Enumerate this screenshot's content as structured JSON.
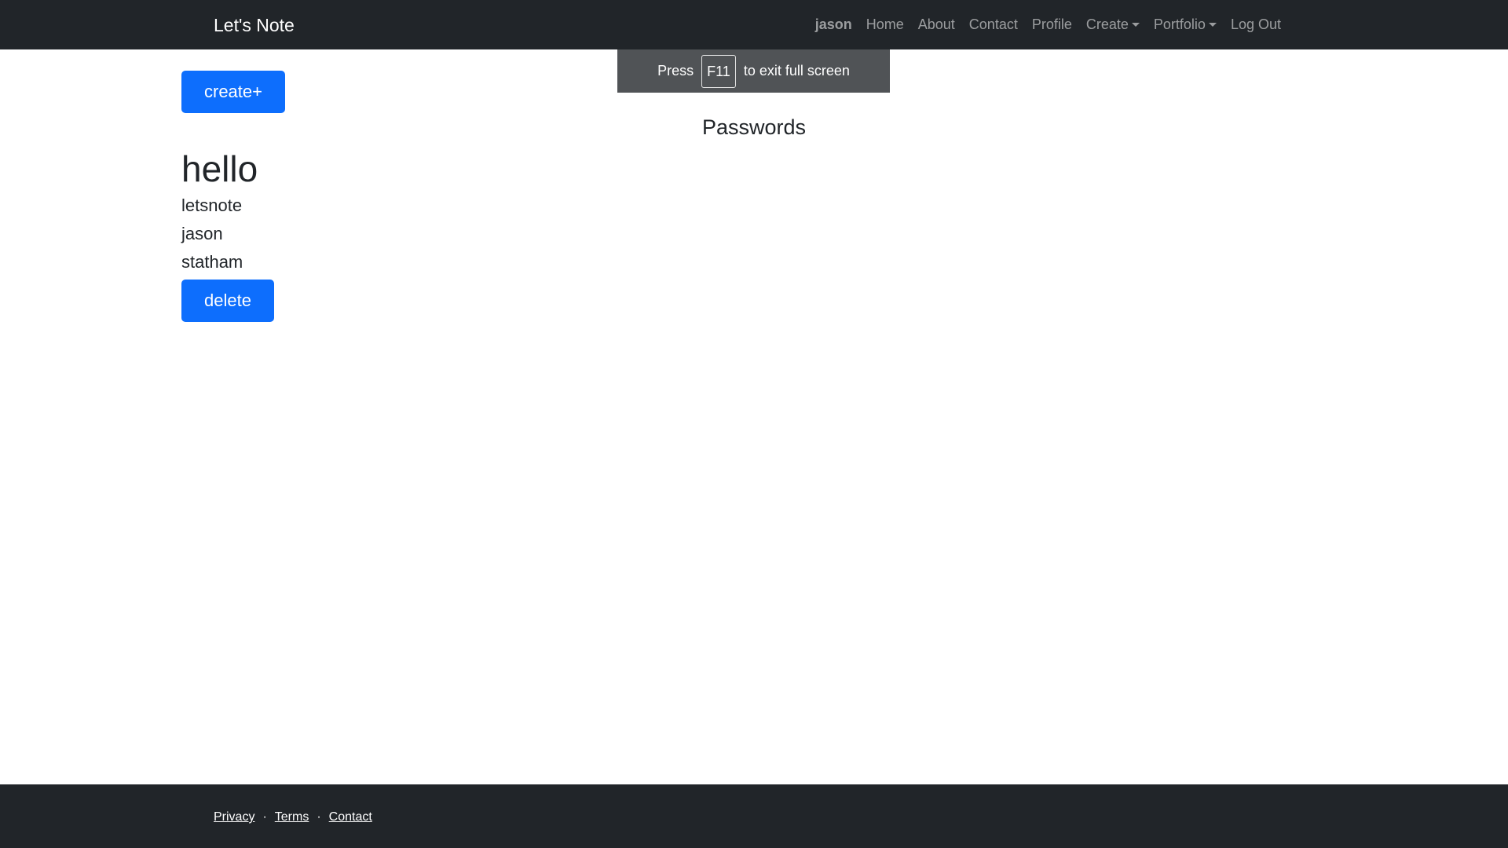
{
  "navbar": {
    "brand": "Let's Note",
    "user": "jason",
    "items": [
      {
        "label": "Home"
      },
      {
        "label": "About"
      },
      {
        "label": "Contact"
      },
      {
        "label": "Profile"
      },
      {
        "label": "Create",
        "dropdown": true
      },
      {
        "label": "Portfolio",
        "dropdown": true
      },
      {
        "label": "Log Out"
      }
    ]
  },
  "fullscreen_toast": {
    "before": "Press",
    "key": "F11",
    "after": "to exit full screen"
  },
  "main": {
    "create_button": "create+",
    "title": "Passwords",
    "note": {
      "title": "hello",
      "lines": [
        "letsnote",
        "jason",
        "statham"
      ],
      "delete_button": "delete"
    }
  },
  "footer": {
    "links": [
      "Privacy",
      "Terms",
      "Contact"
    ],
    "separator": "·"
  },
  "colors": {
    "navbar_bg": "#212529",
    "primary": "#0d6efd",
    "toast_bg": "#505356"
  }
}
